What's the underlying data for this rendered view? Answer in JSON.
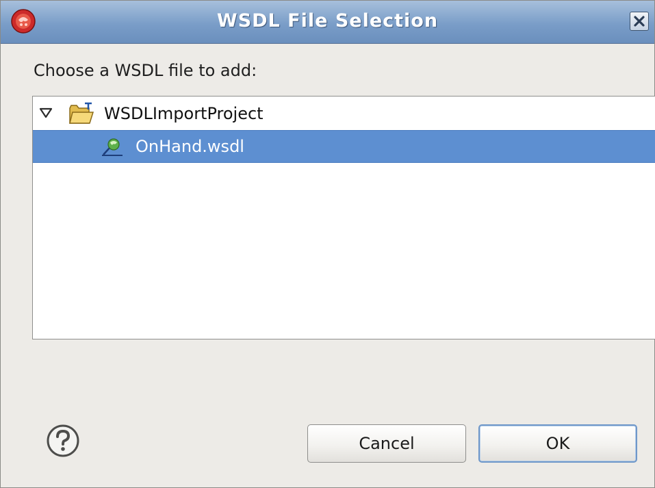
{
  "window": {
    "title": "WSDL File Selection"
  },
  "prompt": "Choose a WSDL file to add:",
  "tree": {
    "items": [
      {
        "label": "WSDLImportProject",
        "expanded": true,
        "icon": "project-folder-icon"
      },
      {
        "label": "OnHand.wsdl",
        "selected": true,
        "icon": "wsdl-file-icon"
      }
    ]
  },
  "buttons": {
    "cancel": "Cancel",
    "ok": "OK"
  },
  "colors": {
    "titlebar": "#7a9dc8",
    "selection": "#5d8fd1",
    "dialog_bg": "#edebe7"
  }
}
